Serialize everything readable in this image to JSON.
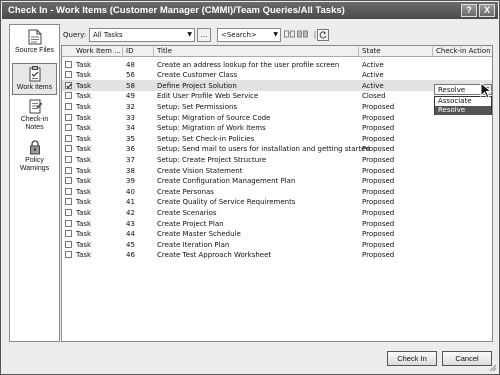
{
  "window": {
    "title": "Check In - Work Items (Customer Manager (CMMI)/Team Queries/All Tasks)",
    "help_label": "?",
    "close_label": "X"
  },
  "sidebar": {
    "items": [
      {
        "label": "Source Files",
        "icon": "source-files-icon"
      },
      {
        "label": "Work Items",
        "icon": "work-items-icon",
        "active": true
      },
      {
        "label": "Check-in Notes",
        "icon": "check-in-notes-icon"
      },
      {
        "label": "Policy Warnings",
        "icon": "policy-warnings-icon"
      }
    ]
  },
  "toolbar": {
    "query_label": "Query:",
    "query_value": "All Tasks",
    "browse_label": "...",
    "search_value": "<Search>"
  },
  "grid": {
    "columns": [
      "Work Item ...",
      "ID",
      "Title",
      "State",
      "Check-in Action"
    ],
    "rows": [
      {
        "type": "Task",
        "id": "48",
        "title": "Create an address lookup for the user profile screen",
        "state": "Active",
        "checked": false
      },
      {
        "type": "Task",
        "id": "56",
        "title": "Create Customer Class",
        "state": "Active",
        "checked": false
      },
      {
        "type": "Task",
        "id": "58",
        "title": "Define Project Solution",
        "state": "Active",
        "checked": true
      },
      {
        "type": "Task",
        "id": "49",
        "title": "Edit User Profile Web Service",
        "state": "Closed",
        "checked": false
      },
      {
        "type": "Task",
        "id": "32",
        "title": "Setup: Set Permissions",
        "state": "Proposed",
        "checked": false
      },
      {
        "type": "Task",
        "id": "33",
        "title": "Setup: Migration of Source Code",
        "state": "Proposed",
        "checked": false
      },
      {
        "type": "Task",
        "id": "34",
        "title": "Setup: Migration of Work Items",
        "state": "Proposed",
        "checked": false
      },
      {
        "type": "Task",
        "id": "35",
        "title": "Setup: Set Check-in Policies",
        "state": "Proposed",
        "checked": false
      },
      {
        "type": "Task",
        "id": "36",
        "title": "Setup: Send mail to users for installation and getting started",
        "state": "Proposed",
        "checked": false
      },
      {
        "type": "Task",
        "id": "37",
        "title": "Setup: Create Project Structure",
        "state": "Proposed",
        "checked": false
      },
      {
        "type": "Task",
        "id": "38",
        "title": "Create Vision Statement",
        "state": "Proposed",
        "checked": false
      },
      {
        "type": "Task",
        "id": "39",
        "title": "Create Configuration Management Plan",
        "state": "Proposed",
        "checked": false
      },
      {
        "type": "Task",
        "id": "40",
        "title": "Create Personas",
        "state": "Proposed",
        "checked": false
      },
      {
        "type": "Task",
        "id": "41",
        "title": "Create Quality of Service Requirements",
        "state": "Proposed",
        "checked": false
      },
      {
        "type": "Task",
        "id": "42",
        "title": "Create Scenarios",
        "state": "Proposed",
        "checked": false
      },
      {
        "type": "Task",
        "id": "43",
        "title": "Create Project Plan",
        "state": "Proposed",
        "checked": false
      },
      {
        "type": "Task",
        "id": "44",
        "title": "Create Master Schedule",
        "state": "Proposed",
        "checked": false
      },
      {
        "type": "Task",
        "id": "45",
        "title": "Create Iteration Plan",
        "state": "Proposed",
        "checked": false
      },
      {
        "type": "Task",
        "id": "46",
        "title": "Create Test Approach Worksheet",
        "state": "Proposed",
        "checked": false
      }
    ],
    "checkin_action": {
      "value": "Resolve",
      "options": [
        "Associate",
        "Resolve"
      ]
    }
  },
  "footer": {
    "checkin_label": "Check In",
    "cancel_label": "Cancel"
  }
}
